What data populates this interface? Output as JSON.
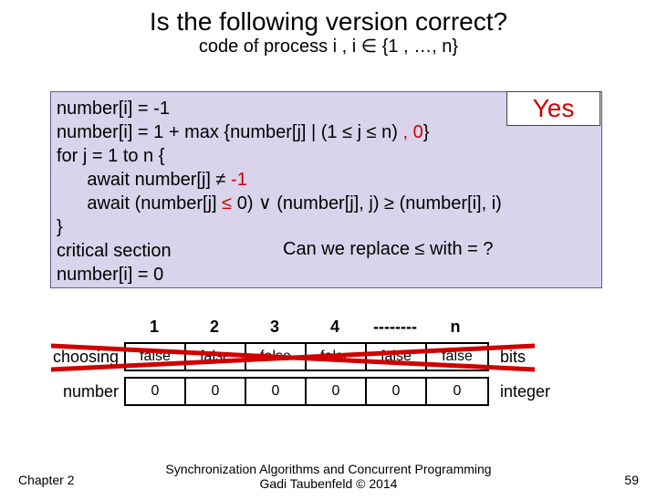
{
  "title": "Is the following version correct?",
  "subtitle": "code of process i ,    i ∈ {1 , …, n}",
  "yes": "Yes",
  "code": {
    "l1": "number[i] = -1",
    "l2a": "number[i] = 1 + max {number[j] | (1 ≤ j ≤ n)",
    "l2b": " , 0",
    "l2c": "}",
    "l3": "for j = 1 to n {",
    "l4a": "      await number[j] ≠ ",
    "l4b": "-1",
    "l5a": "      await (number[j] ",
    "l5b": "≤",
    "l5c": " 0) ∨ (number[j], j) ≥ (number[i], i)",
    "l6": "}",
    "l7": "critical section",
    "l8": "number[i] = 0"
  },
  "question": "Can we replace ≤ with = ?",
  "headers": [
    "1",
    "2",
    "3",
    "4",
    "--------",
    "n"
  ],
  "choosing": {
    "label": "choosing",
    "cells": [
      "false",
      "false",
      "false",
      "false",
      "false",
      "false"
    ],
    "type": "bits"
  },
  "number": {
    "label": "number",
    "cells": [
      "0",
      "0",
      "0",
      "0",
      "0",
      "0"
    ],
    "type": "integer"
  },
  "footer": {
    "left": "Chapter 2",
    "center1": "Synchronization Algorithms and Concurrent Programming",
    "center2": "Gadi Taubenfeld © 2014",
    "right": "59"
  }
}
